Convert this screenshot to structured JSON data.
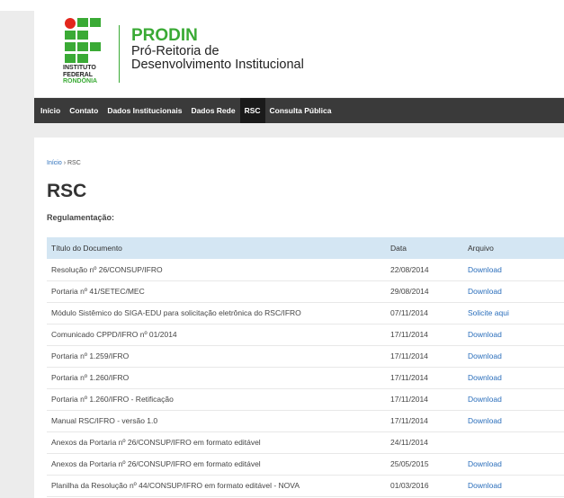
{
  "header": {
    "logo_text": [
      "INSTITUTO",
      "FEDERAL"
    ],
    "logo_region": "RONDÔNIA",
    "brand_name": "PRODIN",
    "brand_sub_1": "Pró-Reitoria de",
    "brand_sub_2": "Desenvolvimento Institucional"
  },
  "nav": {
    "items": [
      {
        "label": "Início",
        "active": false
      },
      {
        "label": "Contato",
        "active": false
      },
      {
        "label": "Dados Institucionais",
        "active": false
      },
      {
        "label": "Dados Rede",
        "active": false
      },
      {
        "label": "RSC",
        "active": true
      },
      {
        "label": "Consulta Pública",
        "active": false
      }
    ]
  },
  "breadcrumb": {
    "home": "Início",
    "separator": "›",
    "current": "RSC"
  },
  "page": {
    "title": "RSC",
    "subhead": "Regulamentação:"
  },
  "table": {
    "headers": [
      "Título do Documento",
      "Data",
      "Arquivo"
    ],
    "rows": [
      {
        "title": "Resolução nº 26/CONSUP/IFRO",
        "date": "22/08/2014",
        "file": "Download"
      },
      {
        "title": "Portaria nº 41/SETEC/MEC",
        "date": "29/08/2014",
        "file": "Download"
      },
      {
        "title": "Módulo Sistêmico do SIGA-EDU para solicitação eletrônica do RSC/IFRO",
        "date": "07/11/2014",
        "file": "Solicite aqui"
      },
      {
        "title": "Comunicado CPPD/IFRO nº 01/2014",
        "date": "17/11/2014",
        "file": "Download"
      },
      {
        "title": "Portaria nº 1.259/IFRO",
        "date": "17/11/2014",
        "file": "Download"
      },
      {
        "title": "Portaria nº 1.260/IFRO",
        "date": "17/11/2014",
        "file": "Download"
      },
      {
        "title": "Portaria nº 1.260/IFRO - Retificação",
        "date": "17/11/2014",
        "file": "Download"
      },
      {
        "title": "Manual RSC/IFRO - versão 1.0",
        "date": "17/11/2014",
        "file": "Download"
      },
      {
        "title": "Anexos da Portaria nº 26/CONSUP/IFRO em formato editável",
        "date": "24/11/2014",
        "file": ""
      },
      {
        "title": "Anexos da Portaria nº 26/CONSUP/IFRO em formato editável",
        "date": "25/05/2015",
        "file": "Download"
      },
      {
        "title": "Planilha da Resolução nº 44/CONSUP/IFRO em formato editável - NOVA",
        "date": "01/03/2016",
        "file": "Download"
      }
    ]
  },
  "colors": {
    "brand_green": "#3aaa35",
    "logo_red": "#e3261c",
    "nav_bg": "#3a3a3a",
    "link": "#2a6ebb",
    "table_header": "#d4e6f3"
  }
}
